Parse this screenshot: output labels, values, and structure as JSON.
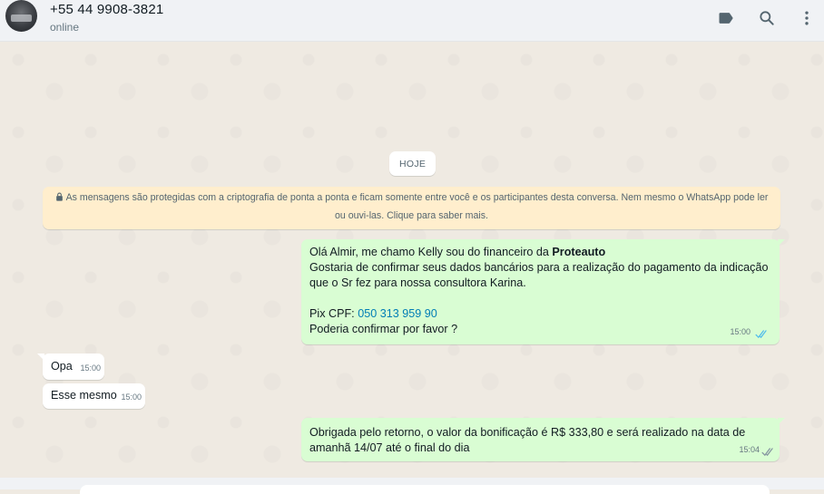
{
  "header": {
    "contact_name": "+55 44 9908-3821",
    "status": "online",
    "icons": [
      "label-icon",
      "search-icon",
      "menu-icon"
    ]
  },
  "chat": {
    "date_chip": "HOJE",
    "encryption_notice": "As mensagens são protegidas com a criptografia de ponta a ponta e ficam somente entre você e os participantes desta conversa. Nem mesmo o WhatsApp pode ler ou ouvi-las. Clique para saber mais.",
    "messages": [
      {
        "direction": "out",
        "greeting": "Olá Almir, me chamo Kelly  sou do financeiro da ",
        "company": "Proteauto",
        "line2": "Gostaria de confirmar seus dados bancários para a realização do pagamento da indicação que o Sr fez para nossa consultora Karina.",
        "pix_label": "Pix CPF: ",
        "pix_value": "050 313 959 90",
        "line4": "Poderia confirmar por favor ?",
        "time": "15:00",
        "status": "read"
      },
      {
        "direction": "in",
        "text": "Opa",
        "time": "15:00"
      },
      {
        "direction": "in",
        "text": "Esse mesmo",
        "time": "15:00"
      },
      {
        "direction": "out",
        "text": "Obrigada pelo retorno, o valor da bonificação é R$ 333,80 e será realizado na data de amanhã 14/07 até o final do dia",
        "time": "15:04",
        "status": "delivered"
      }
    ]
  },
  "colors": {
    "outgoing_bubble": "#d9fdd3",
    "incoming_bubble": "#ffffff",
    "read_ticks": "#53bdeb",
    "delivered_ticks": "#8696a0",
    "notice_bg": "#ffeecd",
    "link": "#027eb5"
  }
}
